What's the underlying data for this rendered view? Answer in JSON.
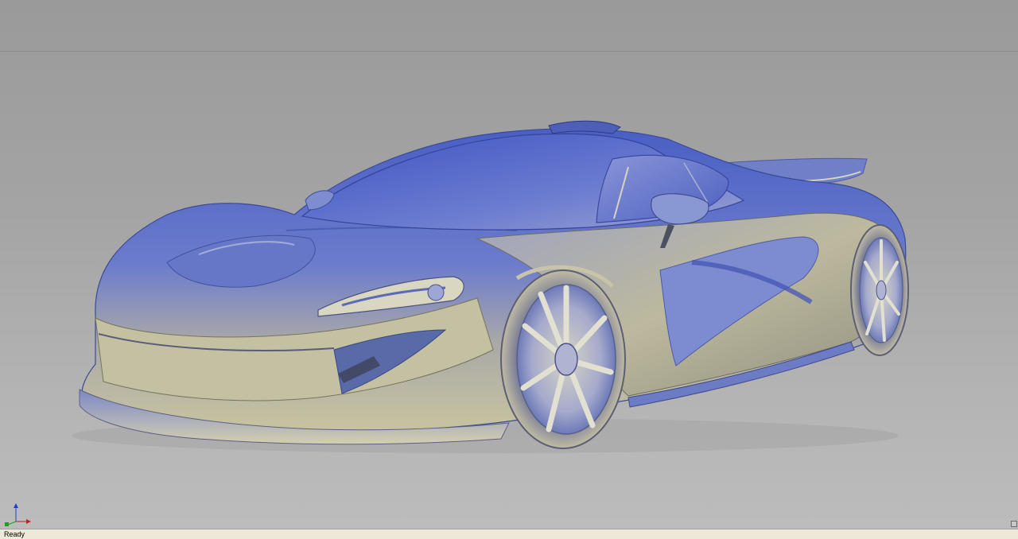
{
  "statusbar": {
    "status": "Ready"
  },
  "viewport": {
    "background_top": "#9a9a9a",
    "background_bottom": "#bcbcbc",
    "model_shading_primary": "#5b6fc8",
    "model_shading_secondary": "#b8b49a"
  },
  "icons": {
    "triad": "coordinate-triad-icon",
    "corner": "resize-grip-icon"
  }
}
